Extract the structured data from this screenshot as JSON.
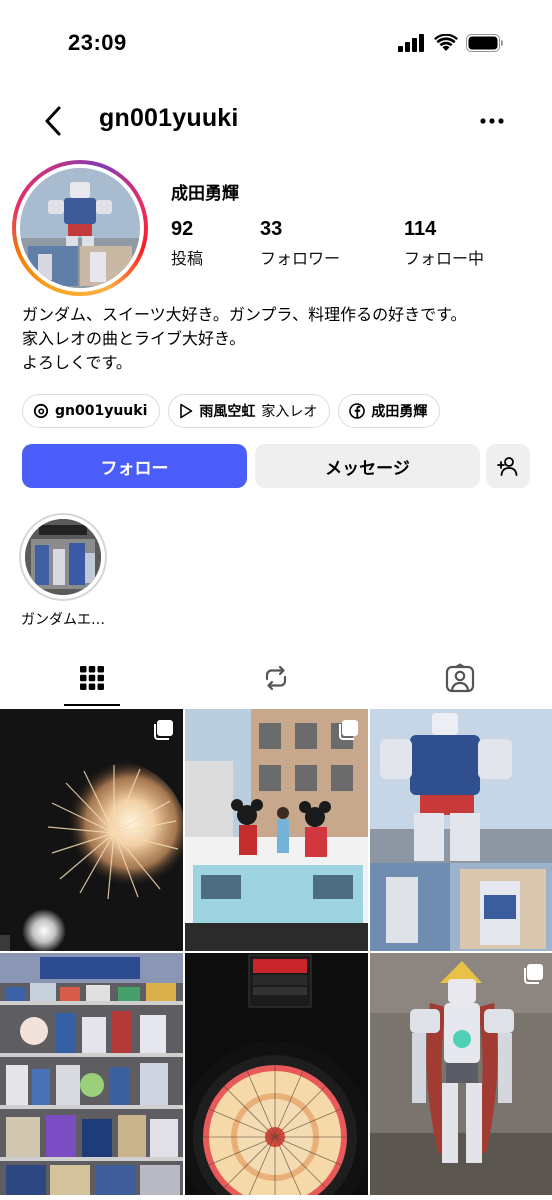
{
  "status": {
    "time": "23:09"
  },
  "header": {
    "username": "gn001yuuki"
  },
  "profile": {
    "full_name": "成田勇輝",
    "stats": [
      {
        "value": "92",
        "label": "投稿"
      },
      {
        "value": "33",
        "label": "フォロワー"
      },
      {
        "value": "114",
        "label": "フォロー中"
      }
    ],
    "bio_lines": [
      "ガンダム、スイーツ大好き。ガンプラ、料理作るの好きです。",
      "家入レオの曲とライブ大好き。",
      "よろしくです。"
    ]
  },
  "chips": [
    {
      "icon": "threads-icon",
      "bold": "gn001yuuki",
      "text": ""
    },
    {
      "icon": "play-icon",
      "bold": "雨風空虹",
      "text": "家入レオ"
    },
    {
      "icon": "facebook-icon",
      "bold": "成田勇輝",
      "text": ""
    }
  ],
  "actions": {
    "follow_label": "フォロー",
    "message_label": "メッセージ"
  },
  "highlight": {
    "label": "ガンダムエ…"
  },
  "colors": {
    "accent": "#4a5df9",
    "button_gray": "#efefef",
    "text": "#000000"
  }
}
